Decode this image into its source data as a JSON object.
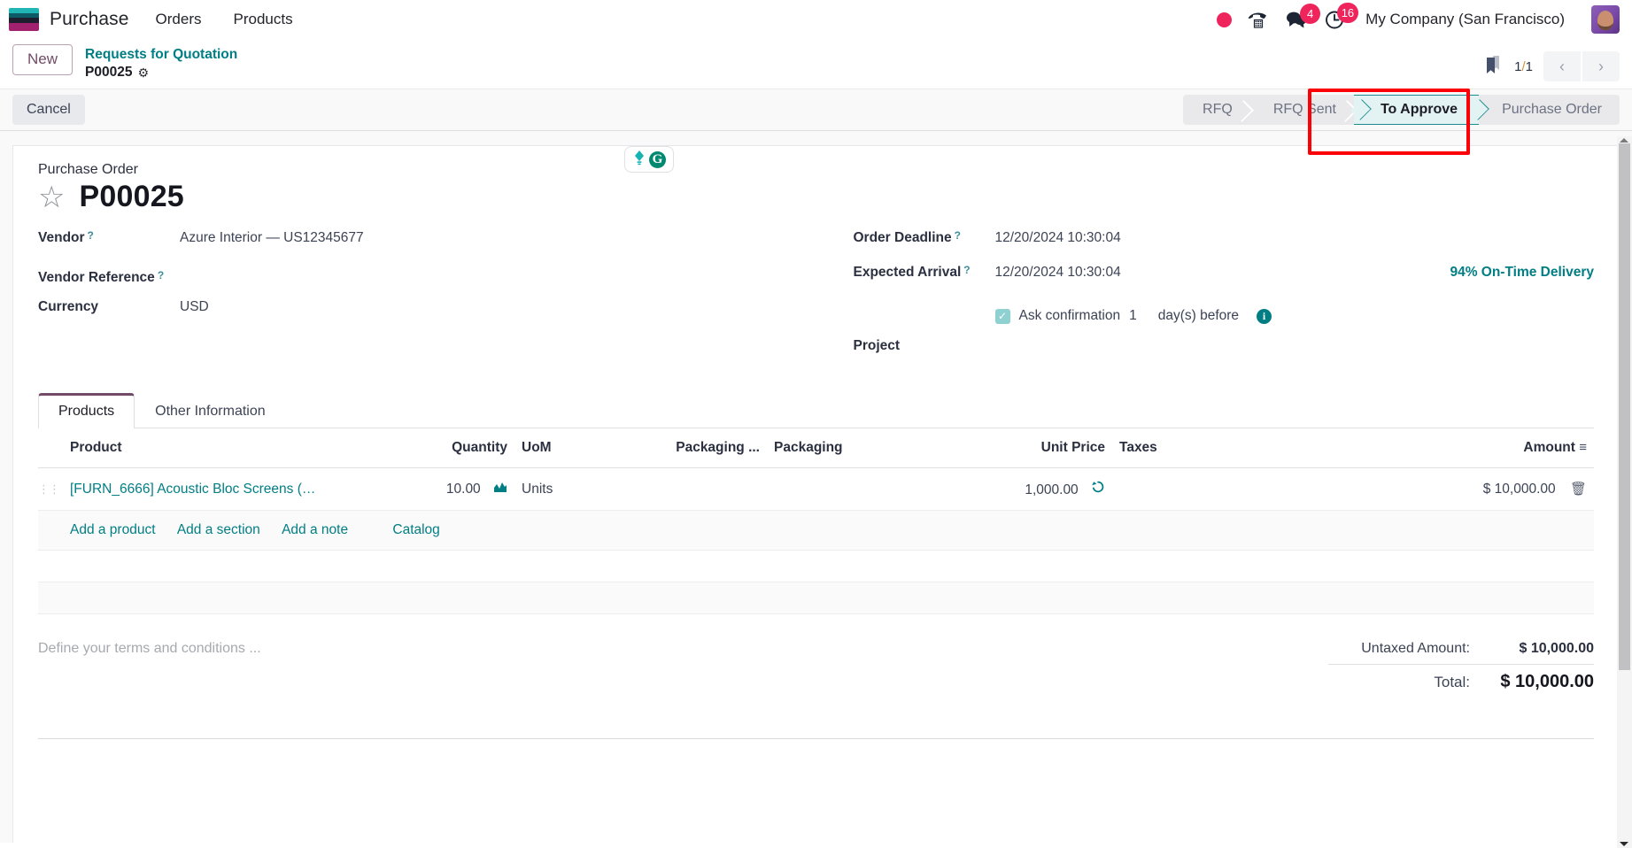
{
  "navbar": {
    "brand": "Purchase",
    "menu": [
      {
        "label": "Orders"
      },
      {
        "label": "Products"
      }
    ],
    "icons": [
      {
        "name": "recording-dot-icon",
        "badge": null
      },
      {
        "name": "phone-dialpad-icon",
        "badge": null
      },
      {
        "name": "messaging-icon",
        "badge": "4"
      },
      {
        "name": "activities-clock-icon",
        "badge": "16"
      }
    ],
    "company": "My Company (San Francisco)",
    "avatar_alt": "user-avatar"
  },
  "control_panel": {
    "new_button": "New",
    "breadcrumb_parent": "Requests for Quotation",
    "breadcrumb_current": "P00025",
    "gear_icon": "gear-icon",
    "bookmark_icon": "bookmark-icon",
    "pager": {
      "current": "1",
      "separator": "/",
      "total": "1"
    },
    "prev_label": "‹",
    "next_label": "›"
  },
  "action_bar": {
    "cancel_button": "Cancel",
    "statusbar": [
      {
        "label": "RFQ",
        "active": false
      },
      {
        "label": "RFQ Sent",
        "active": false
      },
      {
        "label": "To Approve",
        "active": true
      },
      {
        "label": "Purchase Order",
        "active": false
      }
    ],
    "highlight_color": "#fb0007",
    "active_step_color": "#e3f3f3"
  },
  "record": {
    "title_label": "Purchase Order",
    "name": "P00025",
    "star_icon": "star-outline-icon"
  },
  "fields_left": [
    {
      "label": "Vendor",
      "tooltip": "?",
      "value": "Azure Interior — US12345677",
      "is_link": false
    },
    {
      "label": "Vendor Reference",
      "tooltip": "?",
      "value": "",
      "is_link": false
    },
    {
      "label": "Currency",
      "tooltip": "",
      "value": "USD",
      "is_link": false
    }
  ],
  "fields_right": [
    {
      "label": "Order Deadline",
      "tooltip": "?",
      "value": "12/20/2024 10:30:04"
    },
    {
      "label": "Expected Arrival",
      "tooltip": "?",
      "value": "12/20/2024 10:30:04"
    },
    {
      "label": "Project",
      "tooltip": "",
      "value": ""
    }
  ],
  "on_time_delivery": "94% On-Time Delivery",
  "confirmation": {
    "checked": true,
    "check_glyph": "✓",
    "text": "Ask confirmation",
    "days": "1",
    "suffix": "day(s) before",
    "info_icon": "info-icon",
    "info_glyph": "i"
  },
  "notebook": {
    "tabs": [
      {
        "label": "Products",
        "active": true
      },
      {
        "label": "Other Information",
        "active": false
      }
    ]
  },
  "lines_table": {
    "columns": [
      "Product",
      "Quantity",
      "UoM",
      "Packaging ...",
      "Packaging",
      "Unit Price",
      "Taxes",
      "Amount"
    ],
    "optional_columns_icon": "column-settings-icon",
    "rows": [
      {
        "handle": "drag-handle-icon",
        "product": "[FURN_6666] Acoustic Bloc Screens (…",
        "quantity": "10.00",
        "forecast_icon": "forecast-chart-icon",
        "uom": "Units",
        "packaging_qty": "",
        "packaging": "",
        "unit_price": "1,000.00",
        "price_history_icon": "price-history-icon",
        "taxes": "",
        "amount": "$ 10,000.00",
        "delete_icon": "trash-icon"
      }
    ],
    "add_links": [
      {
        "label": "Add a product",
        "spaced": false
      },
      {
        "label": "Add a section",
        "spaced": false
      },
      {
        "label": "Add a note",
        "spaced": false
      },
      {
        "label": "Catalog",
        "spaced": true
      }
    ]
  },
  "footer": {
    "terms_placeholder": "Define your terms and conditions ...",
    "ai_bulb_icon": "lightbulb-icon",
    "ai_grammarly_icon": "grammarly-icon",
    "totals": [
      {
        "label": "Untaxed Amount:",
        "value": "$ 10,000.00",
        "grand": false
      },
      {
        "label": "Total:",
        "value": "$ 10,000.00",
        "grand": true
      }
    ]
  }
}
